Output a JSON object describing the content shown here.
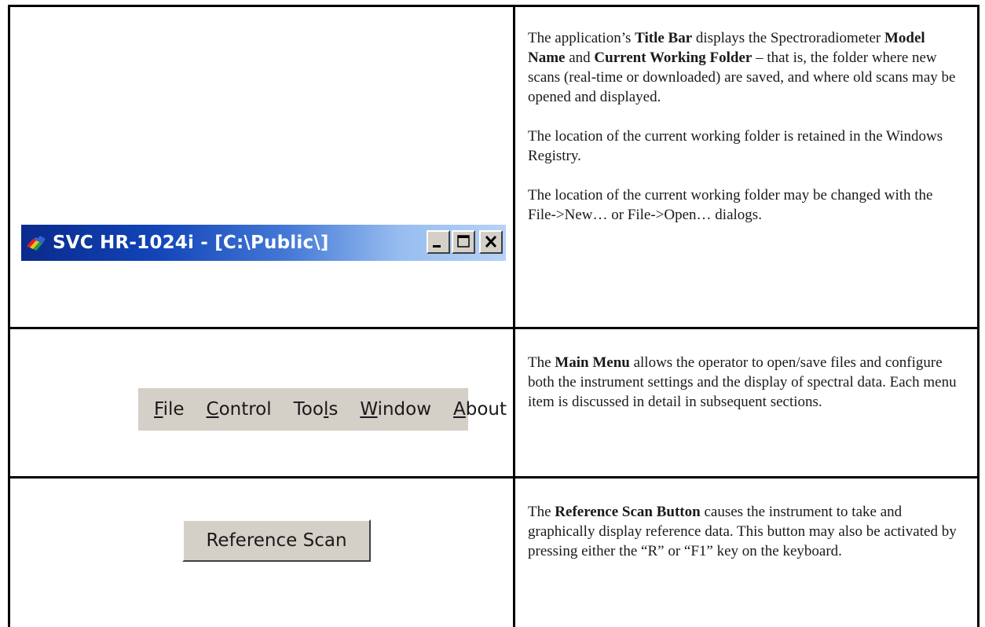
{
  "rows": [
    {
      "title_bar_sample": {
        "text": "SVC HR-1024i - [C:\\Public\\]",
        "icon": "app-icon",
        "buttons": [
          "minimize-icon",
          "maximize-icon",
          "close-icon"
        ]
      },
      "description": [
        {
          "p1_a": "The application’s ",
          "p1_b": "Title Bar",
          "p1_c": " displays the Spectroradiometer ",
          "p1_d": "Model Name",
          "p1_e": " and ",
          "p1_f": "Current Working Folder",
          "p1_g": " – that is, the folder where new scans (real-time or downloaded) are saved, and where old scans may be opened and displayed."
        },
        "The location of the current working folder is retained in the Windows Registry.",
        "The location of the current working folder may be changed with the File->New… or File->Open… dialogs."
      ]
    },
    {
      "menu_sample": {
        "items": [
          {
            "u": "F",
            "rest": "ile"
          },
          {
            "u": "C",
            "rest": "ontrol"
          },
          {
            "pre": "Too",
            "u": "l",
            "rest": "s"
          },
          {
            "u": "W",
            "rest": "indow"
          },
          {
            "u": "A",
            "rest": "bout"
          }
        ]
      },
      "description": {
        "a": "The ",
        "b": "Main Menu",
        "c": " allows the operator to open/save files and configure both the instrument settings and the display of spectral data. Each menu item is discussed in detail in subsequent sections."
      }
    },
    {
      "button_sample": {
        "label": "Reference Scan"
      },
      "description": {
        "a": "The ",
        "b": "Reference Scan Button",
        "c": " causes the instrument to take and graphically display reference data. This button may also be activated by pressing either the “R” or “F1” key on the keyboard."
      }
    }
  ]
}
